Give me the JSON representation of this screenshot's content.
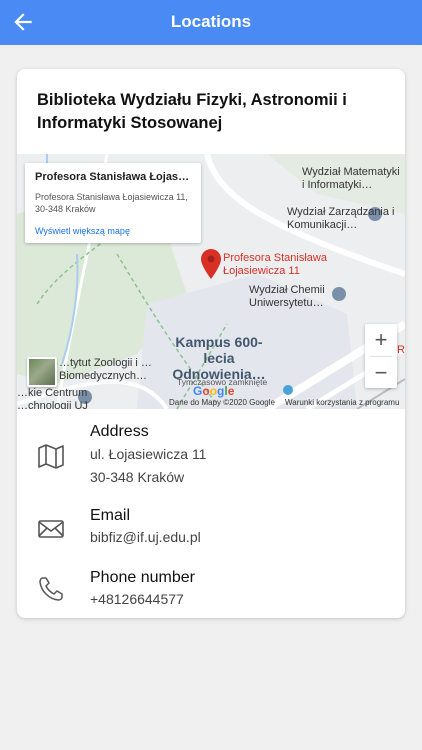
{
  "appbar": {
    "title": "Locations"
  },
  "card": {
    "title": "Biblioteka Wydziału Fizyki, Astronomii i Informatyki Stosowanej"
  },
  "map": {
    "infobox": {
      "title": "Profesora Stanisława Łojasie…",
      "address": "Profesora Stanisława Łojasiewicza 11, 30-348 Kraków",
      "link": "Wyświetl większą mapę"
    },
    "labels": {
      "pin": "Profesora Stanisława Łojasiewicza 11",
      "math": "Wydział Matematyki i Informatyki…",
      "management": "Wydział Zarządzania i Komunikacji…",
      "chemistry": "Wydział Chemii Uniwersytetu…",
      "zoology": "…tytut Zoologii i …Biomedycznych…",
      "centrum": "…kie Centrum …chnologii UJ",
      "campus": "Kampus 600-lecia Odnowienia…",
      "center_small": "Tymczasowo zamknięte",
      "edge_r": "R"
    },
    "google": [
      "G",
      "o",
      "o",
      "g",
      "l",
      "e"
    ],
    "copyright": "Dane do Mapy ©2020 Google",
    "terms": "Warunki korzystania z programu",
    "zoom_in": "+",
    "zoom_out": "−"
  },
  "address": {
    "label": "Address",
    "line1": "ul. Łojasiewicza 11",
    "line2": "30-348 Kraków"
  },
  "email": {
    "label": "Email",
    "value": "bibfiz@if.uj.edu.pl"
  },
  "phone": {
    "label": "Phone number",
    "value": "+48126644577"
  },
  "colors": {
    "appbar": "#4a8af4",
    "pin": "#d93025",
    "link": "#1a73e8"
  }
}
